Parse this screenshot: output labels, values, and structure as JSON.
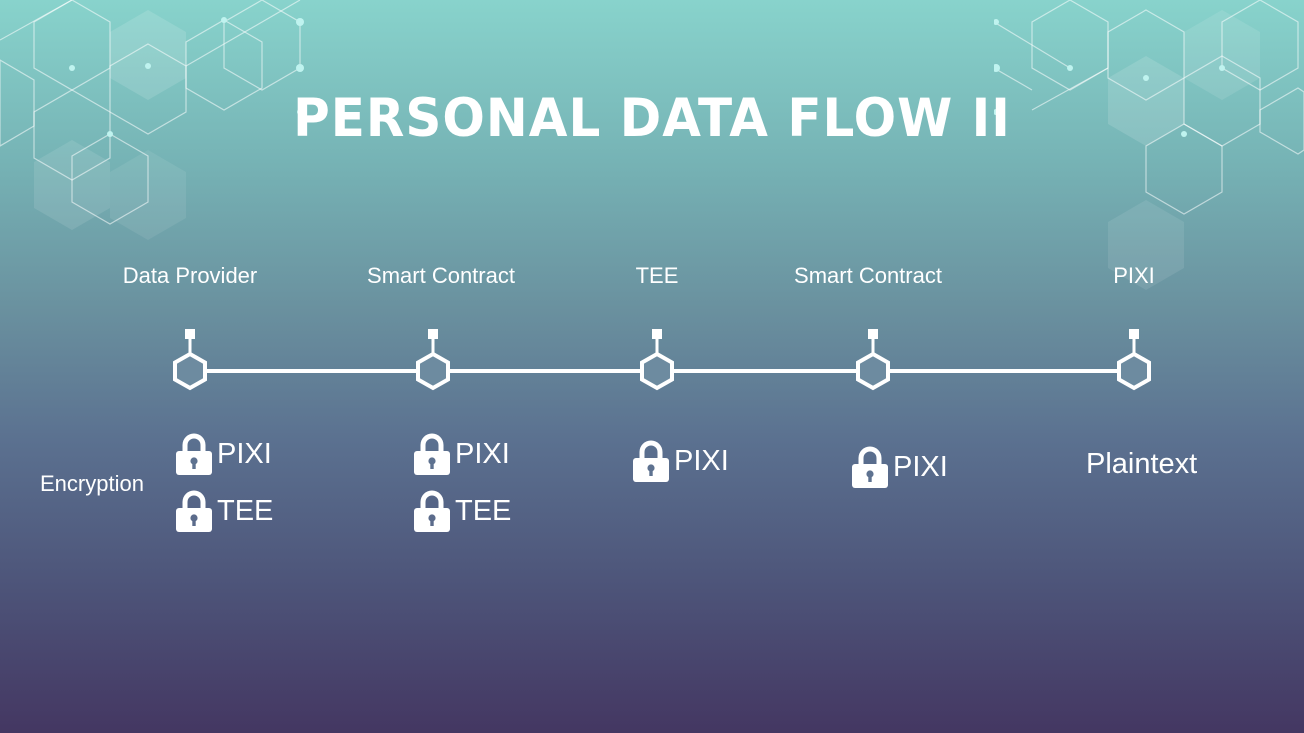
{
  "title": "PERSONAL DATA FLOW II",
  "stages": [
    {
      "label": "Data Provider"
    },
    {
      "label": "Smart Contract"
    },
    {
      "label": "TEE"
    },
    {
      "label": "Smart Contract"
    },
    {
      "label": "PIXI"
    }
  ],
  "encryption": {
    "row_label": "Encryption",
    "columns": [
      {
        "items": [
          "PIXI",
          "TEE"
        ]
      },
      {
        "items": [
          "PIXI",
          "TEE"
        ]
      },
      {
        "items": [
          "PIXI"
        ]
      },
      {
        "items": [
          "PIXI"
        ]
      },
      {
        "plain": "Plaintext"
      }
    ]
  },
  "colors": {
    "gradient_top": "#88d3cc",
    "gradient_bottom": "#443762",
    "foreground": "#ffffff"
  },
  "icons": {
    "lock": "padlock-icon",
    "node": "hexagon-node-icon",
    "decoration": "hexagon-pattern"
  }
}
